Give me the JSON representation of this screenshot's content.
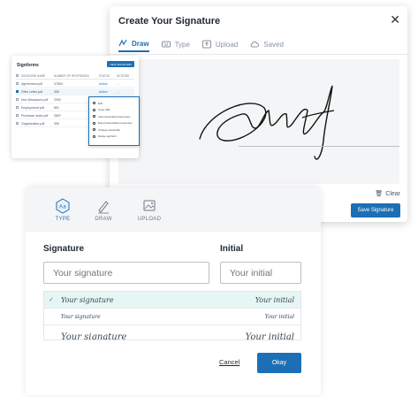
{
  "signature_modal": {
    "title": "Create Your Signature",
    "close_icon": "close-icon",
    "tabs": [
      {
        "label": "Draw",
        "icon": "pen-draw-icon",
        "active": true
      },
      {
        "label": "Type",
        "icon": "keyboard-icon",
        "active": false
      },
      {
        "label": "Upload",
        "icon": "upload-icon",
        "active": false
      },
      {
        "label": "Saved",
        "icon": "cloud-icon",
        "active": false
      }
    ],
    "clear_label": "Clear",
    "save_label": "Save Signature",
    "accent_color": "#1c6fb5"
  },
  "signforms": {
    "title": "Signforms",
    "button_label": "NEW SIGNFORM",
    "columns": [
      "SIGNFORM NAME",
      "NUMBER OF RESPONSES",
      "STATUS",
      "ACTIONS"
    ],
    "rows": [
      {
        "name": "Agreement.pdf",
        "responses": "37800",
        "status": "Active",
        "actions": "...",
        "selected": false
      },
      {
        "name": "Offer Letter.pdf",
        "responses": "350",
        "status": "Active",
        "actions": "...",
        "selected": true
      },
      {
        "name": "Non Disclosure.pdf",
        "responses": "2392",
        "status": "",
        "actions": "",
        "selected": false
      },
      {
        "name": "Employment.pdf",
        "responses": "891",
        "status": "",
        "actions": "",
        "selected": false
      },
      {
        "name": "Purchase order.pdf",
        "responses": "2897",
        "status": "",
        "actions": "",
        "selected": false
      },
      {
        "name": "Organization.pdf",
        "responses": "350",
        "status": "",
        "actions": "",
        "selected": false
      }
    ],
    "menu_items": [
      {
        "label": "Edit",
        "icon": "pencil-icon"
      },
      {
        "label": "Copy URL",
        "icon": "link-icon"
      },
      {
        "label": "View associated responses",
        "icon": "eye-icon"
      },
      {
        "label": "Export associated responses",
        "icon": "export-icon"
      },
      {
        "label": "Change ownership",
        "icon": "user-icon"
      },
      {
        "label": "Delete signform",
        "icon": "trash-icon"
      }
    ]
  },
  "front_panel": {
    "tabs": [
      {
        "label": "TYPE",
        "icon": "text-aa-icon",
        "active": true
      },
      {
        "label": "DRAW",
        "icon": "pen-icon",
        "active": false
      },
      {
        "label": "UPLOAD",
        "icon": "image-icon",
        "active": false
      }
    ],
    "signature_label": "Signature",
    "initial_label": "Initial",
    "signature_placeholder": "Your signature",
    "initial_placeholder": "Your initial",
    "style_options": [
      {
        "signature": "Your signature",
        "initial": "Your initial",
        "selected": true
      },
      {
        "signature": "Your signature",
        "initial": "Your initial",
        "selected": false
      },
      {
        "signature": "Your signature",
        "initial": "Your initial",
        "selected": false
      }
    ],
    "cancel_label": "Cancel",
    "okay_label": "Okay"
  }
}
